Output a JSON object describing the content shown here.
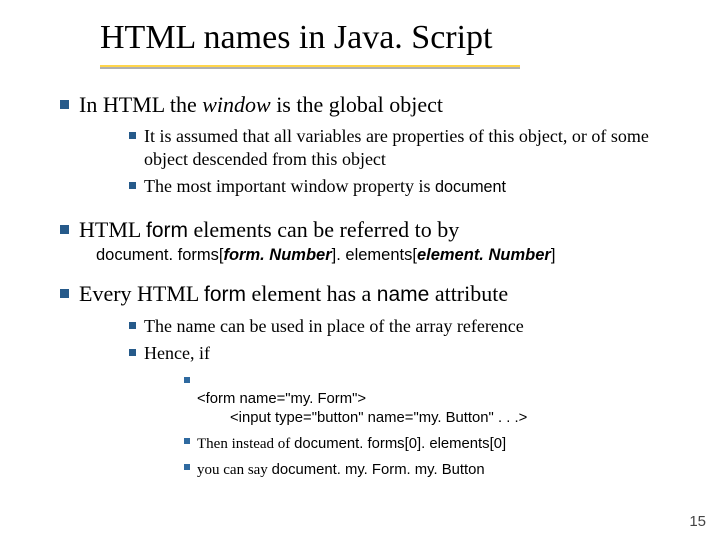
{
  "title": "HTML names in Java. Script",
  "b1": {
    "pre": "In HTML the ",
    "em": "window",
    "post": " is the global object",
    "sub": {
      "s1": "It is assumed that all variables are properties of this object, or of some object descended from this object",
      "s2_pre": "The most important window property is ",
      "s2_code": "document"
    }
  },
  "b2": {
    "pre": "HTML ",
    "code": "form",
    "post": " elements can be referred to by",
    "line_p1": "document. forms[",
    "line_em1": "form. Number",
    "line_p2": "]. elements[",
    "line_em2": "element. Number",
    "line_p3": "]"
  },
  "b3": {
    "pre": "Every HTML ",
    "code1": "form",
    "mid": " element has a ",
    "code2": "name",
    "post": " attribute",
    "sub": {
      "s1": "The name can be used in place of the array reference",
      "s2": "Hence, if",
      "c1": "<form name=\"my. Form\">",
      "c1b": "        <input type=\"button\" name=\"my. Button\" . . .>",
      "c2_pre": "Then instead of  ",
      "c2_code": "document. forms[0]. elements[0]",
      "c3_pre": "you can say ",
      "c3_code": "document. my. Form. my. Button"
    }
  },
  "page": "15"
}
